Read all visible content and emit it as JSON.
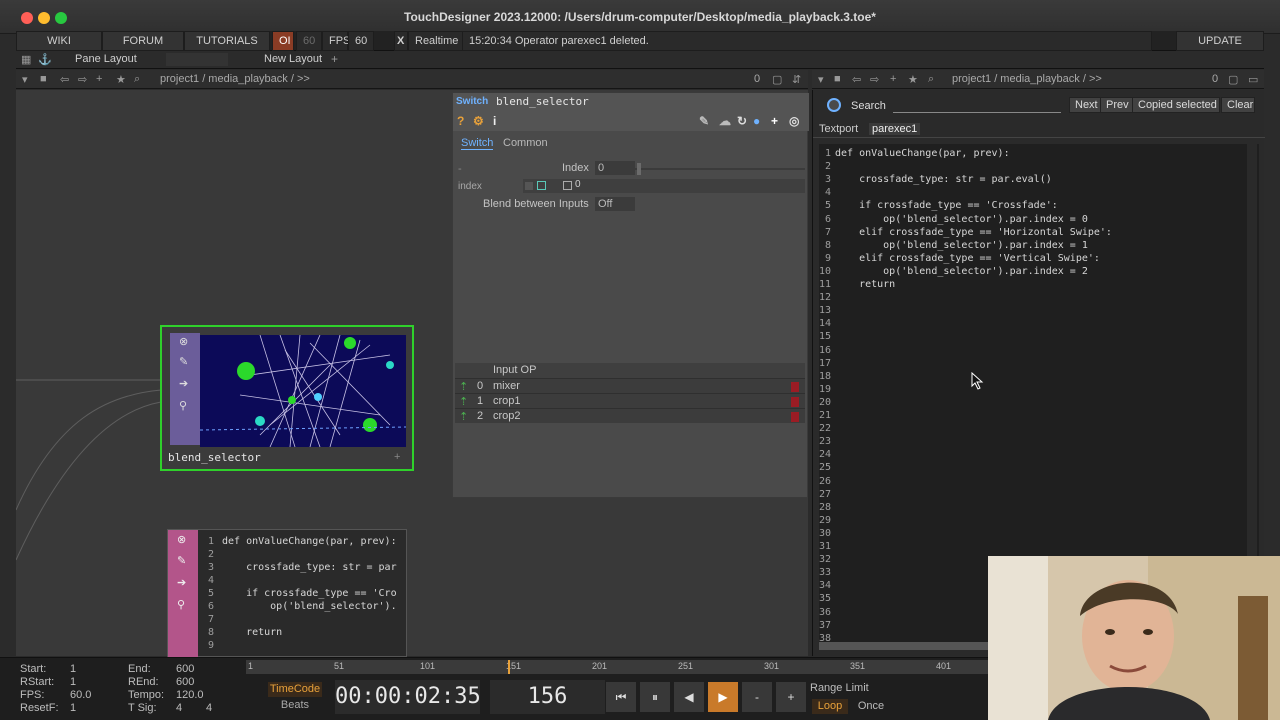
{
  "window": {
    "title": "TouchDesigner 2023.12000: /Users/drum-computer/Desktop/media_playback.3.toe*"
  },
  "menubar": {
    "wiki": "WIKI",
    "forum": "FORUM",
    "tutorials": "TUTORIALS",
    "oi": "OI",
    "fps_limit": "60",
    "fps_label": "FPS:",
    "fps_value": "60",
    "realtime_check": "X",
    "realtime": "Realtime",
    "status": "15:20:34 Operator parexec1 deleted.",
    "update": "UPDATE"
  },
  "layoutbar": {
    "pane_layout": "Pane Layout",
    "new_layout": "New Layout",
    "plus": "+"
  },
  "left_pane": {
    "path": "project1 / media_playback / >>",
    "count": "0"
  },
  "right_pane": {
    "path": "project1 / media_playback / >>",
    "count": "0"
  },
  "node": {
    "label": "blend_selector"
  },
  "param": {
    "type": "Switch",
    "name": "blend_selector",
    "tabs": [
      "Switch",
      "Common"
    ],
    "index_label": "Index",
    "index_value": "0",
    "index_row_label": "index",
    "index_row_value": "0",
    "dash": "-",
    "blend_label": "Blend between Inputs",
    "blend_value": "Off",
    "inputs_header": "Input OP",
    "inputs": [
      {
        "idx": "0",
        "name": "mixer"
      },
      {
        "idx": "1",
        "name": "crop1"
      },
      {
        "idx": "2",
        "name": "crop2"
      }
    ]
  },
  "textport": {
    "search_label": "Search",
    "next": "Next",
    "prev": "Prev",
    "copied": "Copied selected text",
    "clear": "Clear",
    "tabs": [
      "Textport",
      "parexec1"
    ],
    "line_numbers": [
      "1",
      "2",
      "3",
      "4",
      "5",
      "6",
      "7",
      "8",
      "9",
      "10",
      "11",
      "12",
      "13",
      "14",
      "15",
      "16",
      "17",
      "18",
      "19",
      "20",
      "21",
      "22",
      "23",
      "24",
      "25",
      "26",
      "27",
      "28",
      "29",
      "30",
      "31",
      "32",
      "33",
      "34",
      "35",
      "36",
      "37",
      "38"
    ],
    "code": [
      "def onValueChange(par, prev):",
      "",
      "    crossfade_type: str = par.eval()",
      "",
      "    if crossfade_type == 'Crossfade':",
      "        op('blend_selector').par.index = 0",
      "    elif crossfade_type == 'Horizontal Swipe':",
      "        op('blend_selector').par.index = 1",
      "    elif crossfade_type == 'Vertical Swipe':",
      "        op('blend_selector').par.index = 2",
      "    return"
    ]
  },
  "dat_preview": {
    "line_numbers": [
      "1",
      "2",
      "3",
      "4",
      "5",
      "6",
      "7",
      "8",
      "9"
    ],
    "code": [
      "def onValueChange(par, prev):",
      "",
      "    crossfade_type: str = par",
      "",
      "    if crossfade_type == 'Cro",
      "        op('blend_selector').",
      "",
      "    return",
      ""
    ]
  },
  "timeline": {
    "start_label": "Start:",
    "start": "1",
    "rstart_label": "RStart:",
    "rstart": "1",
    "fps_label": "FPS:",
    "fps": "60.0",
    "resetf_label": "ResetF:",
    "resetf": "1",
    "end_label": "End:",
    "end": "600",
    "rend_label": "REnd:",
    "rend": "600",
    "tempo_label": "Tempo:",
    "tempo": "120.0",
    "tsig_label": "T Sig:",
    "tsig_a": "4",
    "tsig_b": "4",
    "ruler_ticks": [
      "1",
      "51",
      "101",
      "151",
      "201",
      "251",
      "301",
      "351",
      "401"
    ],
    "timecode_btn": "TimeCode",
    "beats_btn": "Beats",
    "timecode": "00:00:02:35",
    "frame": "156",
    "range_limit": "Range Limit",
    "loop": "Loop",
    "once": "Once",
    "minus": "-",
    "plus": "+"
  },
  "colors": {
    "accent_green": "#2fd12b",
    "accent_orange": "#e8a13a",
    "param_blue": "#6fb2ff"
  }
}
